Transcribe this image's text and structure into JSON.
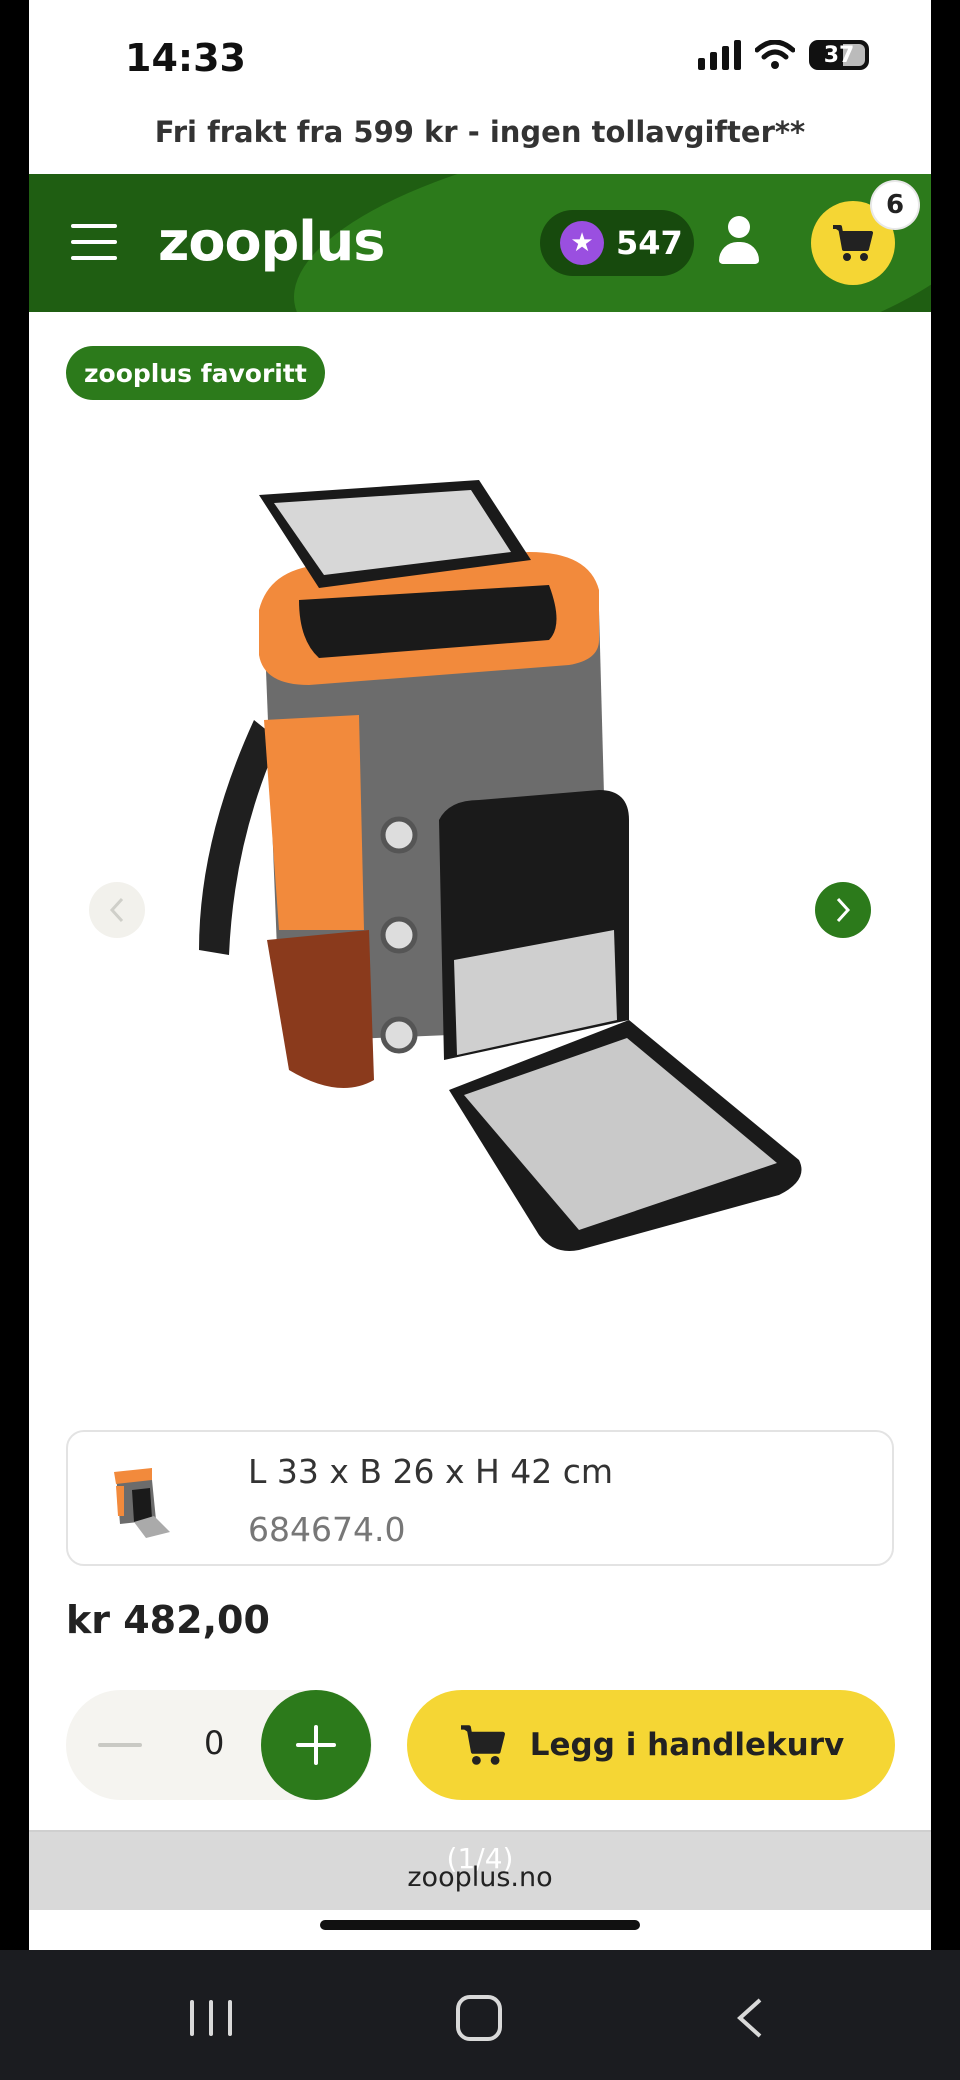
{
  "status_bar": {
    "time": "14:33",
    "battery": "37"
  },
  "promo_text": "Fri frakt fra 599 kr - ingen tollavgifter**",
  "header": {
    "logo": "zooplus",
    "points": "547",
    "cart_count": "6"
  },
  "badge": "zooplus favoritt",
  "product": {
    "variant_size": "L 33 x B 26 x H 42 cm",
    "variant_sku": "684674.0",
    "price": "kr 482,00",
    "quantity": "0",
    "add_to_cart_label": "Legg i handlekurv"
  },
  "browser": {
    "pager": "(1/4)",
    "url": "zooplus.no"
  },
  "colors": {
    "brand_green": "#2c7a1b",
    "header_green": "#1f5e12",
    "accent_yellow": "#f5d634",
    "points_purple": "#9a4fe0"
  },
  "icons": [
    "menu-icon",
    "star-icon",
    "user-icon",
    "cart-icon",
    "chevron-left-icon",
    "chevron-right-icon",
    "minus-icon",
    "plus-icon"
  ]
}
